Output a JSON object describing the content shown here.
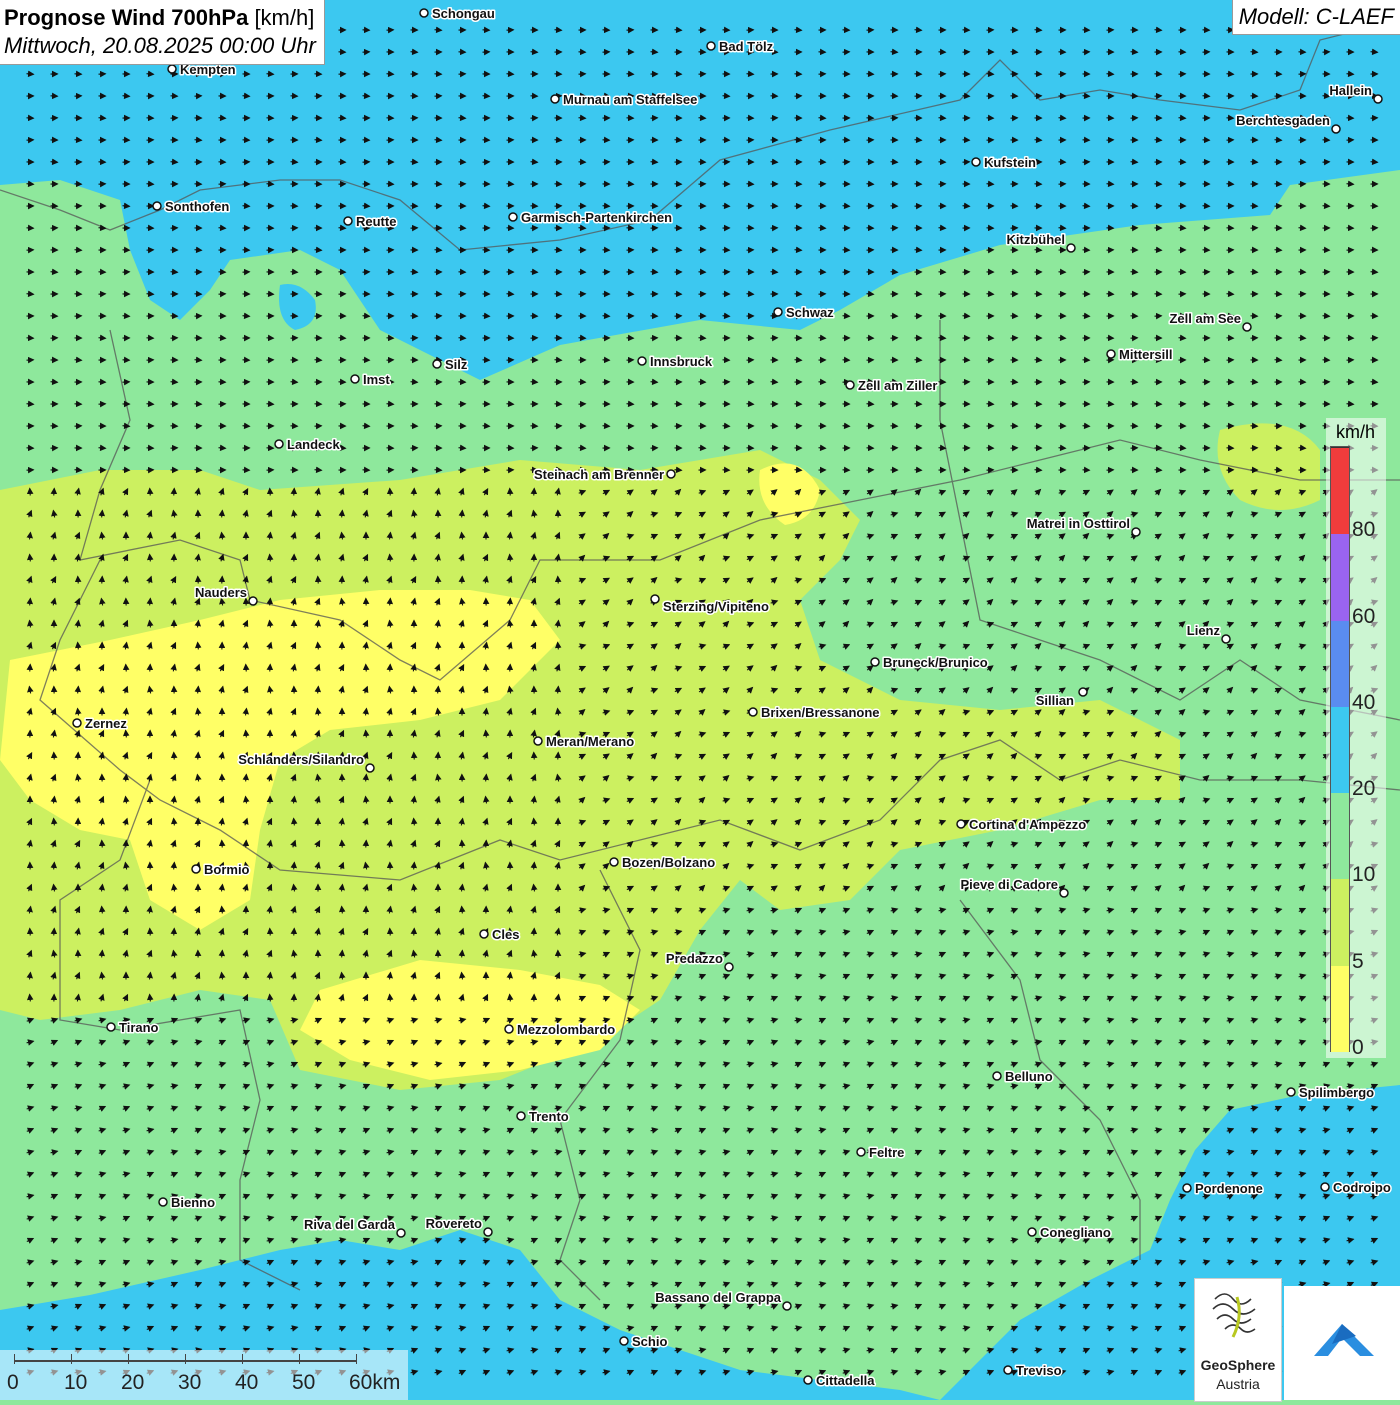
{
  "header": {
    "title_bold": "Prognose Wind 700hPa",
    "title_unit": "[km/h]",
    "datetime": "Mittwoch, 20.08.2025 00:00 Uhr",
    "model": "Modell: C-LAEF"
  },
  "legend": {
    "unit": "km/h",
    "segments": [
      {
        "from": 0,
        "to": 5,
        "color": "#ffff66"
      },
      {
        "from": 5,
        "to": 10,
        "color": "#ccf060"
      },
      {
        "from": 10,
        "to": 20,
        "color": "#8ee89c"
      },
      {
        "from": 20,
        "to": 40,
        "color": "#3cc8f0"
      },
      {
        "from": 40,
        "to": 60,
        "color": "#5a8cf0"
      },
      {
        "from": 60,
        "to": 80,
        "color": "#9a64f0"
      },
      {
        "from": 80,
        "to": 100,
        "color": "#f03c3c"
      }
    ],
    "tick_labels": [
      "0",
      "5",
      "10",
      "20",
      "40",
      "60",
      "80"
    ]
  },
  "scale_bar": {
    "labels": [
      "0",
      "10",
      "20",
      "30",
      "40",
      "50",
      "60km"
    ]
  },
  "cities": [
    {
      "name": "Schongau"
    },
    {
      "name": "Bad Tölz"
    },
    {
      "name": "Kempten"
    },
    {
      "name": "Murnau am Staffelsee"
    },
    {
      "name": "Hallein"
    },
    {
      "name": "Berchtesgaden"
    },
    {
      "name": "Kufstein"
    },
    {
      "name": "Sonthofen"
    },
    {
      "name": "Reutte"
    },
    {
      "name": "Garmisch-Partenkirchen"
    },
    {
      "name": "Kitzbühel"
    },
    {
      "name": "Schwaz"
    },
    {
      "name": "Zell am See"
    },
    {
      "name": "Mittersill"
    },
    {
      "name": "Silz"
    },
    {
      "name": "Innsbruck"
    },
    {
      "name": "Imst"
    },
    {
      "name": "Zell am Ziller"
    },
    {
      "name": "Landeck"
    },
    {
      "name": "Steinach am Brenner"
    },
    {
      "name": "Matrei in Osttirol"
    },
    {
      "name": "Nauders"
    },
    {
      "name": "Sterzing/Vipiteno"
    },
    {
      "name": "Lienz"
    },
    {
      "name": "Bruneck/Brunico"
    },
    {
      "name": "Sillian"
    },
    {
      "name": "Zernez"
    },
    {
      "name": "Brixen/Bressanone"
    },
    {
      "name": "Meran/Merano"
    },
    {
      "name": "Schlanders/Silandro"
    },
    {
      "name": "Cortina d'Ampezzo"
    },
    {
      "name": "Bozen/Bolzano"
    },
    {
      "name": "Bormio"
    },
    {
      "name": "Pieve di Cadore"
    },
    {
      "name": "Cles"
    },
    {
      "name": "Predazzo"
    },
    {
      "name": "Tirano"
    },
    {
      "name": "Mezzolombardo"
    },
    {
      "name": "Belluno"
    },
    {
      "name": "Spilimbergo"
    },
    {
      "name": "Trento"
    },
    {
      "name": "Feltre"
    },
    {
      "name": "Bienno"
    },
    {
      "name": "Pordenone"
    },
    {
      "name": "Codroipo"
    },
    {
      "name": "Riva del Garda"
    },
    {
      "name": "Rovereto"
    },
    {
      "name": "Conegliano"
    },
    {
      "name": "Bassano del Grappa"
    },
    {
      "name": "Schio"
    },
    {
      "name": "Treviso"
    },
    {
      "name": "Cittadella"
    }
  ],
  "logo": {
    "line1": "GeoSphere",
    "line2": "Austria"
  }
}
